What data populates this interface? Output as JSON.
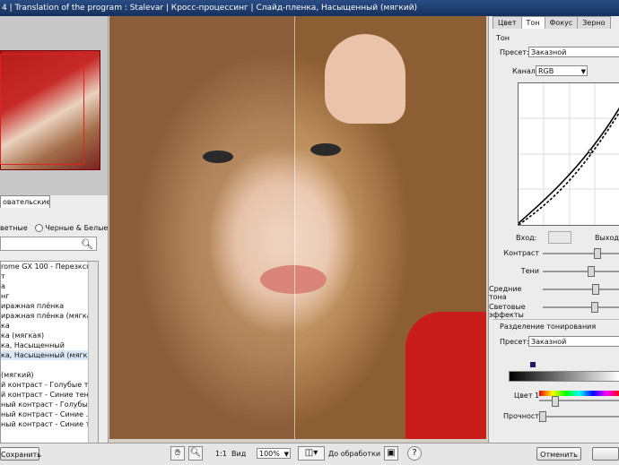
{
  "window": {
    "title": "4 | Translation of the program : Stalevar | Кросс-процессинг | Слайд-пленка, Насыщенный (мягкий)"
  },
  "left": {
    "tab": "овательские",
    "radio_color": "ветные",
    "radio_bw": "Черные & Белые",
    "presets": [
      "rome GX 100 - Перезкспо...",
      "т",
      "а",
      "нг",
      "иражная плёнка",
      "иражная плёнка (мягкая)",
      "ка",
      "ка (мягкая)",
      "ка, Насыщенный",
      "ка, Насыщенный (мягкий)",
      "",
      "(мягкий)",
      "й контраст - Голубые тени",
      "й контраст - Синие тени",
      "ный контраст - Голубые...",
      "ный контраст - Синие ...",
      "ный контраст - Синие те..."
    ],
    "selected_index": 9
  },
  "right": {
    "tabs": [
      "Цвет",
      "Тон",
      "Фокус",
      "Зерно"
    ],
    "active_tab": 1,
    "tone_group": "Тон",
    "preset_label": "Пресет:",
    "preset_value": "Заказной",
    "channel_label": "Канал:",
    "channel_value": "RGB",
    "input_label": "Вход:",
    "output_label": "Выход:",
    "sliders": [
      {
        "label": "Контраст",
        "value": 0.7
      },
      {
        "label": "Тени",
        "value": 0.62
      },
      {
        "label": "Средние тона",
        "value": 0.68
      },
      {
        "label": "Световые эффекты",
        "value": 0.66
      }
    ],
    "split_group": "Разделение тонирования",
    "split_preset_label": "Пресет:",
    "split_preset_value": "Заказной",
    "color_label": "Цвет 1",
    "strength_label": "Прочность"
  },
  "bottom": {
    "save": "Сохранить",
    "one_to_one": "1:1",
    "view_label": "Вид",
    "zoom": "100%",
    "before_label": "До обработки",
    "cancel": "Отменить",
    "help": "?"
  }
}
